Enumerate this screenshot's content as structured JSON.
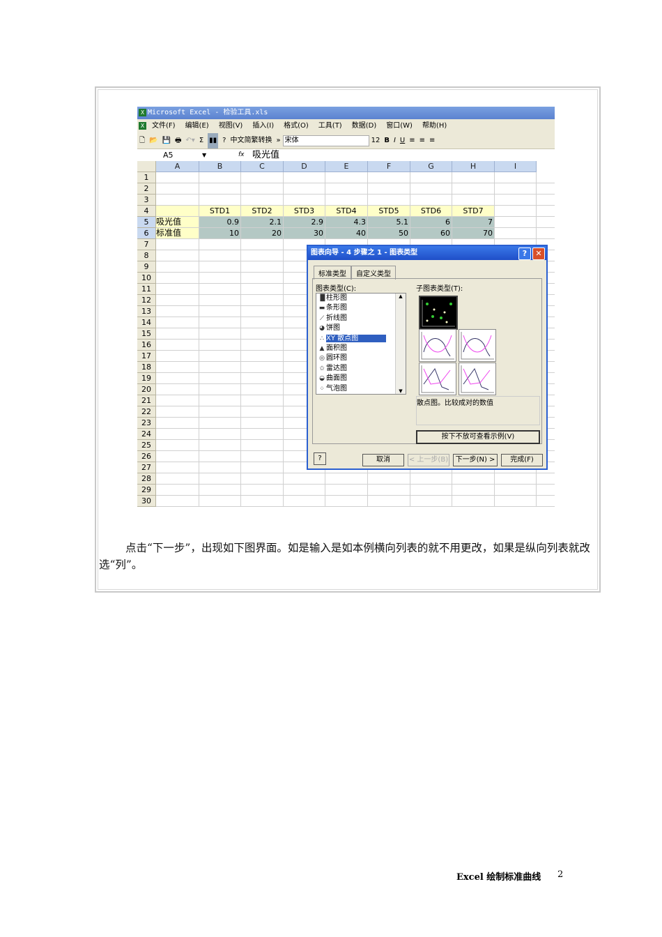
{
  "excel": {
    "title": "Microsoft Excel - 检验工具.xls",
    "menu": [
      "文件(F)",
      "编辑(E)",
      "视图(V)",
      "插入(I)",
      "格式(O)",
      "工具(T)",
      "数据(D)",
      "窗口(W)",
      "帮助(H)"
    ],
    "toolbar": {
      "convert": "中文简繁转换",
      "font": "宋体",
      "size": "12",
      "bold": "B",
      "italic": "I",
      "underline": "U",
      "sigma": "Σ"
    },
    "namebox": "A5",
    "fx": "fx",
    "formula": "吸光值",
    "columns": [
      "A",
      "B",
      "C",
      "D",
      "E",
      "F",
      "G",
      "H",
      "I"
    ],
    "rows": [
      "1",
      "2",
      "3",
      "4",
      "5",
      "6",
      "7",
      "8",
      "9",
      "10",
      "11",
      "12",
      "13",
      "14",
      "15",
      "16",
      "17",
      "18",
      "19",
      "20",
      "21",
      "22",
      "23",
      "24",
      "25",
      "26",
      "27",
      "28",
      "29",
      "30"
    ],
    "row4": [
      "",
      "STD1",
      "STD2",
      "STD3",
      "STD4",
      "STD5",
      "STD6",
      "STD7"
    ],
    "row5": [
      "吸光值",
      "0.9",
      "2.1",
      "2.9",
      "4.3",
      "5.1",
      "6",
      "7"
    ],
    "row6": [
      "标准值",
      "10",
      "20",
      "30",
      "40",
      "50",
      "60",
      "70"
    ]
  },
  "dialog": {
    "title": "图表向导 - 4 步骤之 1 - 图表类型",
    "tabs": [
      "标准类型",
      "自定义类型"
    ],
    "chart_type_label": "图表类型(C):",
    "sub_type_label": "子图表类型(T):",
    "types": [
      "柱形图",
      "条形图",
      "折线图",
      "饼图",
      "XY 散点图",
      "面积图",
      "圆环图",
      "雷达图",
      "曲面图",
      "气泡图"
    ],
    "description": "散点图。比较成对的数值",
    "preview_button": "按下不放可查看示例(V)",
    "buttons": {
      "cancel": "取消",
      "back": "< 上一步(B)",
      "next": "下一步(N) >",
      "finish": "完成(F)"
    }
  },
  "body_text": "点击“下一步”，出现如下图界面。如是输入是如本例横向列表的就不用更改，如果是纵向列表就改选“列”。",
  "footer": {
    "title": "Excel 绘制标准曲线",
    "page": "2"
  }
}
